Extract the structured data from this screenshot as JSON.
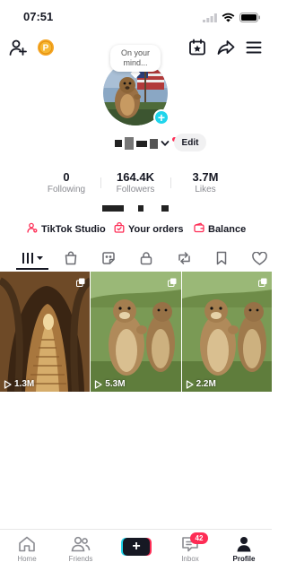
{
  "status_bar": {
    "time": "07:51"
  },
  "profile": {
    "bubble_text": "On your mind...",
    "edit_label": "Edit"
  },
  "stats": [
    {
      "value": "0",
      "label": "Following"
    },
    {
      "value": "164.4K",
      "label": "Followers"
    },
    {
      "value": "3.7M",
      "label": "Likes"
    }
  ],
  "links": {
    "studio": "TikTok Studio",
    "orders": "Your orders",
    "balance": "Balance"
  },
  "tabs": [
    "videos",
    "shop",
    "favorites-sticker",
    "private",
    "reposts",
    "saved",
    "liked"
  ],
  "videos": [
    {
      "views": "1.3M",
      "theme": "tunnel"
    },
    {
      "views": "5.3M",
      "theme": "marmot"
    },
    {
      "views": "2.2M",
      "theme": "marmot"
    }
  ],
  "bottom_nav": {
    "home": "Home",
    "friends": "Friends",
    "inbox": "Inbox",
    "inbox_badge": "42",
    "profile": "Profile"
  },
  "colors": {
    "accent_pink": "#fe2c55",
    "accent_cyan": "#20d5ec",
    "points_badge": "#f5a524"
  }
}
